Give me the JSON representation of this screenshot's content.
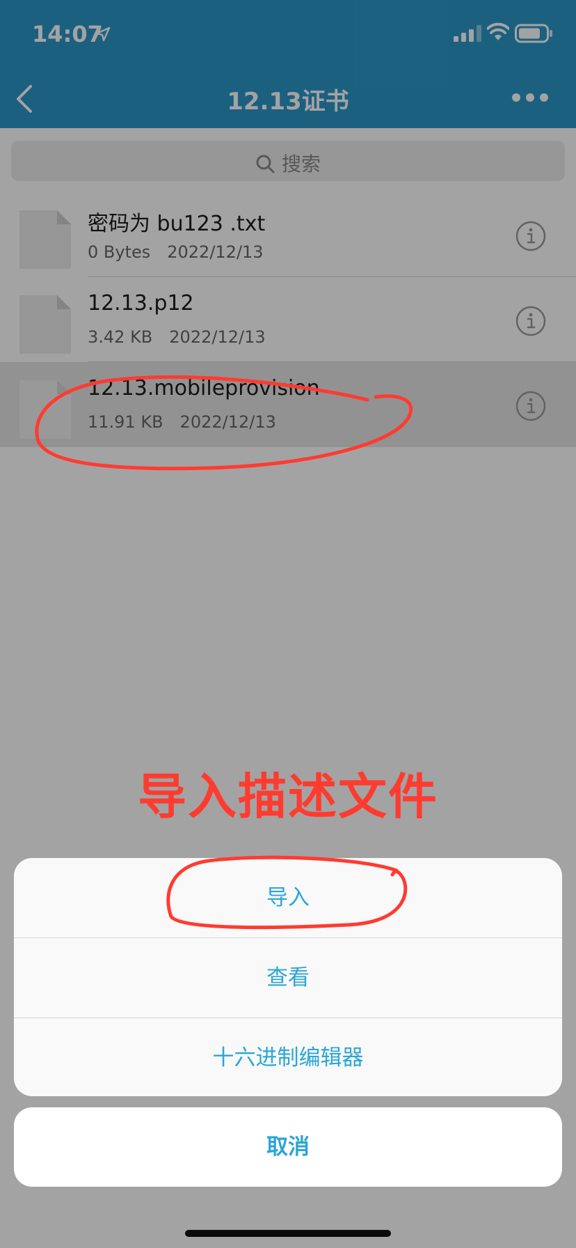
{
  "status_bar": {
    "time": "14:07"
  },
  "nav": {
    "title": "12.13证书"
  },
  "search": {
    "placeholder": "搜索"
  },
  "files": [
    {
      "name": "密码为 bu123 .txt",
      "size": "0 Bytes",
      "date": "2022/12/13"
    },
    {
      "name": "12.13.p12",
      "size": "3.42 KB",
      "date": "2022/12/13"
    },
    {
      "name": "12.13.mobileprovision",
      "size": "11.91 KB",
      "date": "2022/12/13",
      "selected": true
    }
  ],
  "annotation": {
    "text": "导入描述文件",
    "color": "#ff3b30"
  },
  "action_sheet": {
    "items": [
      "导入",
      "查看",
      "十六进制编辑器"
    ],
    "cancel": "取消"
  },
  "colors": {
    "header": "#2c97c8",
    "action_text": "#2ba6d8",
    "annotation": "#ff3b30"
  }
}
